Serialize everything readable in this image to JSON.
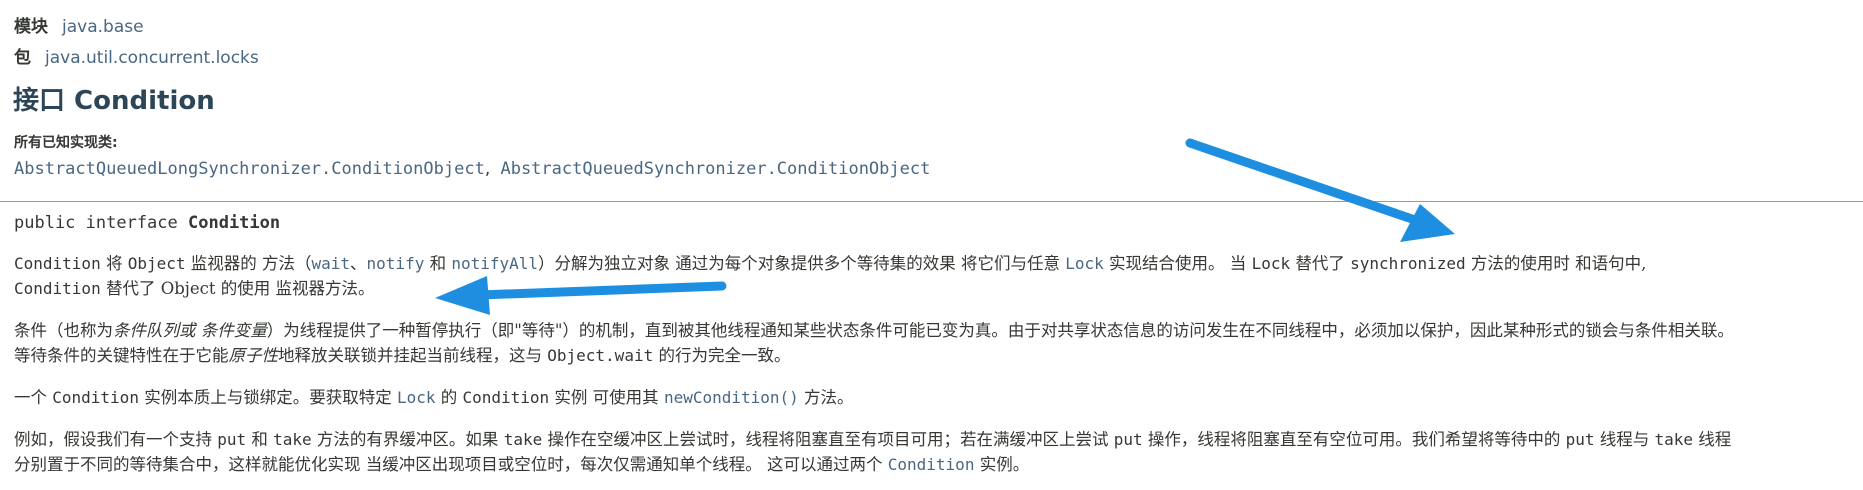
{
  "header": {
    "module_label": "模块",
    "module_value": "java.base",
    "package_label": "包",
    "package_value": "java.util.concurrent.locks"
  },
  "title": "接口 Condition",
  "implementing": {
    "label": "所有已知实现类:",
    "items": [
      "AbstractQueuedLongSynchronizer.ConditionObject",
      "AbstractQueuedSynchronizer.ConditionObject"
    ],
    "separator": ","
  },
  "signature": {
    "prefix": "public interface ",
    "name": "Condition"
  },
  "p1": {
    "t1": "Condition",
    "t2": " 将 ",
    "t3": "Object",
    "t4": " 监视器的 方法（",
    "t5": "wait",
    "t6": "、",
    "t7": "notify",
    "t8": " 和 ",
    "t9": "notifyAll",
    "t10": "）分解为独立对象 通过为每个对象提供多个等待集的效果 将它们与任意 ",
    "t11": "Lock",
    "t12": " 实现结合使用。 当 ",
    "t13": "Lock",
    "t14": " 替代了 ",
    "t15": "synchronized",
    "t16": " 方法的使用时 和语句中,",
    "t17": "Condition",
    "t18": " 替代了 Object 的使用 监视器方法。"
  },
  "p2": {
    "t1": "条件（也称为",
    "t2": "条件队列或 条件变量",
    "t3": "）为线程提供了一种暂停执行（即\"等待\"）的机制，直到被其他线程通知某些状态条件可能已变为真。由于对共享状态信息的访问发生在不同线程中，必须加以保护，因此某种形式的锁会与条件相关联。",
    "t4": "等待条件的关键特性在于它能",
    "t5": "原子性",
    "t6": "地释放关联锁并挂起当前线程，这与 ",
    "t7": "Object.wait",
    "t8": " 的行为完全一致。"
  },
  "p3": {
    "t1": "一个 ",
    "t2": "Condition",
    "t3": " 实例本质上与锁绑定。要获取特定 ",
    "t4": "Lock",
    "t5": " 的 ",
    "t6": "Condition",
    "t7": " 实例 可使用其 ",
    "t8": "newCondition()",
    "t9": " 方法。"
  },
  "p4": {
    "t1": "例如，假设我们有一个支持 ",
    "t2": "put",
    "t3": " 和 ",
    "t4": "take",
    "t5": " 方法的有界缓冲区。如果 ",
    "t6": "take",
    "t7": " 操作在空缓冲区上尝试时，线程将阻塞直至有项目可用；若在满缓冲区上尝试 ",
    "t8": "put",
    "t9": " 操作，线程将阻塞直至有空位可用。我们希望将等待中的 ",
    "t10": "put",
    "t11": " 线程与 ",
    "t12": "take",
    "t13": " 线程",
    "t14": "分别置于不同的等待集合中，这样就能优化实现 当缓冲区出现项目或空位时，每次仅需通知单个线程。 这可以通过两个 ",
    "t15": "Condition",
    "t16": " 实例。"
  },
  "colors": {
    "link": "#4a6782",
    "text": "#353833",
    "title": "#2c4557",
    "annotation_arrow": "#1e8fe0"
  }
}
